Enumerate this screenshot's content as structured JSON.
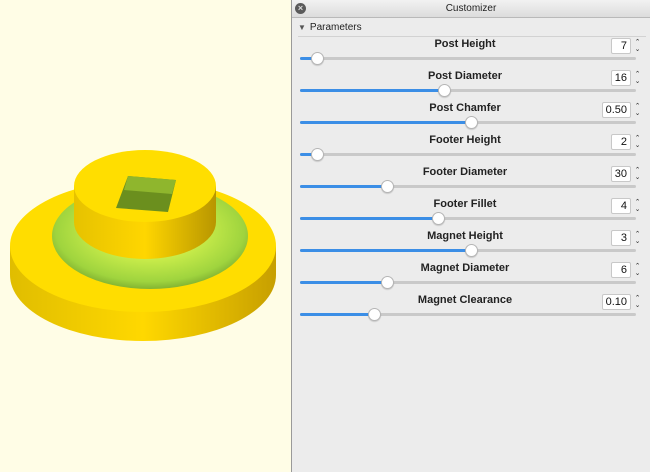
{
  "viewport": {
    "model_colors": {
      "yellow": "#ffdd00",
      "shadow": "#c7a800",
      "green": "#a8d84a"
    }
  },
  "window": {
    "title": "Customizer"
  },
  "section": {
    "label": "Parameters"
  },
  "params": [
    {
      "label": "Post Height",
      "value": "7",
      "fraction": 0.05
    },
    {
      "label": "Post Diameter",
      "value": "16",
      "fraction": 0.43
    },
    {
      "label": "Post Chamfer",
      "value": "0.50",
      "fraction": 0.51
    },
    {
      "label": "Footer Height",
      "value": "2",
      "fraction": 0.05
    },
    {
      "label": "Footer Diameter",
      "value": "30",
      "fraction": 0.26
    },
    {
      "label": "Footer Fillet",
      "value": "4",
      "fraction": 0.41
    },
    {
      "label": "Magnet Height",
      "value": "3",
      "fraction": 0.51
    },
    {
      "label": "Magnet Diameter",
      "value": "6",
      "fraction": 0.26
    },
    {
      "label": "Magnet Clearance",
      "value": "0.10",
      "fraction": 0.22
    }
  ],
  "colors": {
    "accent": "#3b8ee6",
    "panel_bg": "#ececec",
    "viewport_bg": "#fffde6"
  }
}
